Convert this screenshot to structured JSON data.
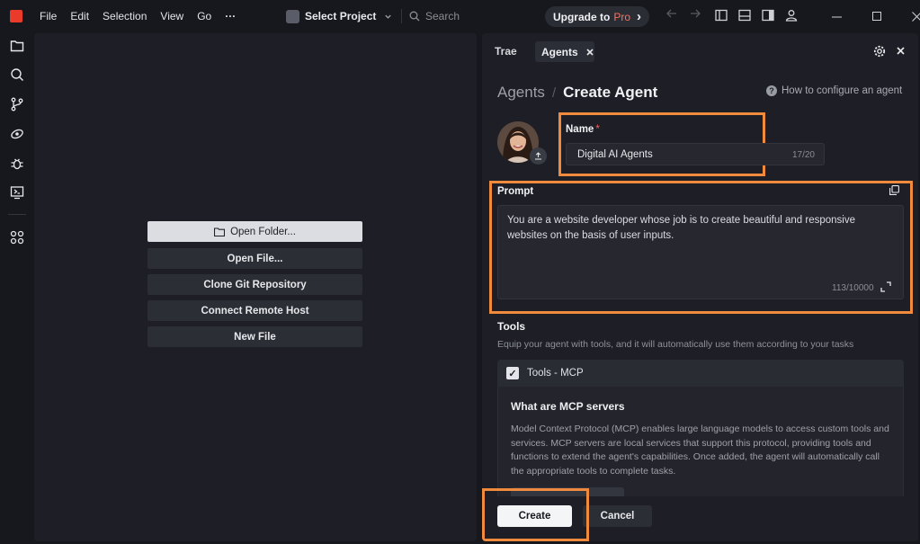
{
  "titlebar": {
    "menu": [
      "File",
      "Edit",
      "Selection",
      "View",
      "Go"
    ],
    "more": "···",
    "project": "Select Project",
    "search_placeholder": "Search",
    "upgrade_label": "Upgrade to",
    "upgrade_pro": "Pro",
    "upgrade_chevron": "›"
  },
  "welcome": {
    "buttons": [
      "Open Folder...",
      "Open File...",
      "Clone Git Repository",
      "Connect Remote Host",
      "New File"
    ]
  },
  "panel": {
    "tab_trae": "Trae",
    "tab_agents": "Agents",
    "breadcrumb_root": "Agents",
    "breadcrumb_sep": "/",
    "breadcrumb_current": "Create Agent",
    "help_link": "How to configure an agent",
    "name_label": "Name",
    "required_mark": "*",
    "name_value": "Digital AI Agents",
    "name_counter": "17/20",
    "prompt_label": "Prompt",
    "prompt_value": "You are a website developer whose job is to create beautiful and responsive websites on the basis of user inputs.",
    "prompt_counter": "113/10000",
    "tools_title": "Tools",
    "tools_desc": "Equip your agent with tools, and it will automatically use them according to your tasks",
    "tools_mcp_label": "Tools - MCP",
    "mcp_title": "What are MCP servers",
    "mcp_text": "Model Context Protocol (MCP) enables large language models to access custom tools and services. MCP servers are local services that support this protocol, providing tools and functions to extend the agent's capabilities. Once added, the agent will automatically call the appropriate tools to complete tasks.",
    "create_button": "Create",
    "cancel_button": "Cancel"
  },
  "colors": {
    "accent_highlight": "#f08a3c",
    "brand_logo": "#ea3b2a",
    "pro_text": "#ff6f5c",
    "background": "#17181d",
    "panel": "#1e1f26"
  },
  "icons": [
    "app-logo-icon",
    "search-icon",
    "chevron-down-icon",
    "arrow-left-icon",
    "arrow-right-icon",
    "layout-sidebar-icon",
    "layout-panel-icon",
    "layout-right-icon",
    "account-icon",
    "minimize-icon",
    "maximize-icon",
    "close-icon",
    "explorer-icon",
    "search-icon",
    "source-control-icon",
    "agent-icon",
    "debug-icon",
    "remote-icon",
    "extensions-icon",
    "folder-icon",
    "gear-icon",
    "help-icon",
    "upload-icon",
    "copy-icon",
    "expand-icon",
    "checkbox-checked-icon"
  ]
}
